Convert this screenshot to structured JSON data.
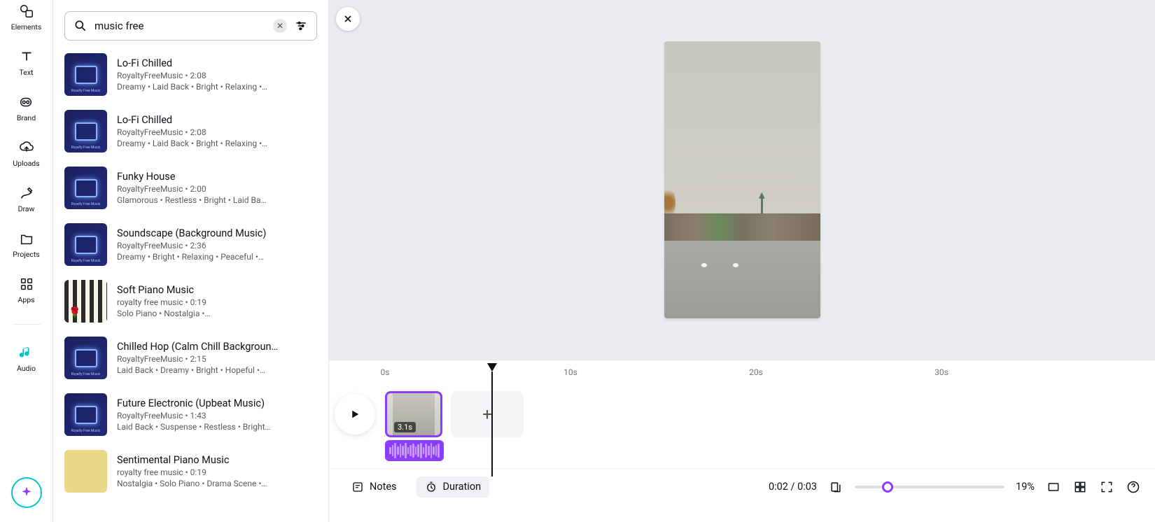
{
  "rail": {
    "elements": "Elements",
    "text": "Text",
    "brand": "Brand",
    "uploads": "Uploads",
    "draw": "Draw",
    "projects": "Projects",
    "apps": "Apps",
    "audio": "Audio"
  },
  "search": {
    "value": "music free"
  },
  "tracks": [
    {
      "title": "Lo-Fi Chilled",
      "artist": "RoyaltyFreeMusic • 2:08",
      "tags": "Dreamy • Laid Back • Bright • Relaxing •…",
      "thumb": "blue"
    },
    {
      "title": "Lo-Fi Chilled",
      "artist": "RoyaltyFreeMusic • 2:08",
      "tags": "Dreamy • Laid Back • Bright • Relaxing •…",
      "thumb": "blue"
    },
    {
      "title": "Funky House",
      "artist": "RoyaltyFreeMusic • 2:00",
      "tags": "Glamorous • Restless • Bright • Laid Ba…",
      "thumb": "blue"
    },
    {
      "title": "Soundscape (Background Music)",
      "artist": "RoyaltyFreeMusic • 2:36",
      "tags": "Dreamy • Bright • Relaxing • Peaceful •…",
      "thumb": "blue"
    },
    {
      "title": "Soft Piano Music",
      "artist": "royalty free music • 0:19",
      "tags": "Solo Piano • Nostalgia •…",
      "thumb": "piano"
    },
    {
      "title": "Chilled Hop (Calm Chill Backgroun…",
      "artist": "RoyaltyFreeMusic • 2:15",
      "tags": "Laid Back • Dreamy • Bright • Hopeful •…",
      "thumb": "blue"
    },
    {
      "title": "Future Electronic (Upbeat Music)",
      "artist": "RoyaltyFreeMusic • 1:43",
      "tags": "Laid Back • Suspense • Restless • Bright…",
      "thumb": "blue"
    },
    {
      "title": "Sentimental Piano Music",
      "artist": "royalty free music • 0:19",
      "tags": "Nostalgia • Solo Piano • Drama Scene •…",
      "thumb": "yellow"
    }
  ],
  "ruler": {
    "t0": "0s",
    "t10": "10s",
    "t20": "20s",
    "t30": "30s"
  },
  "clip": {
    "duration": "3.1s"
  },
  "footer": {
    "notes": "Notes",
    "duration": "Duration",
    "time": "0:02 / 0:03",
    "zoom": "19%"
  }
}
